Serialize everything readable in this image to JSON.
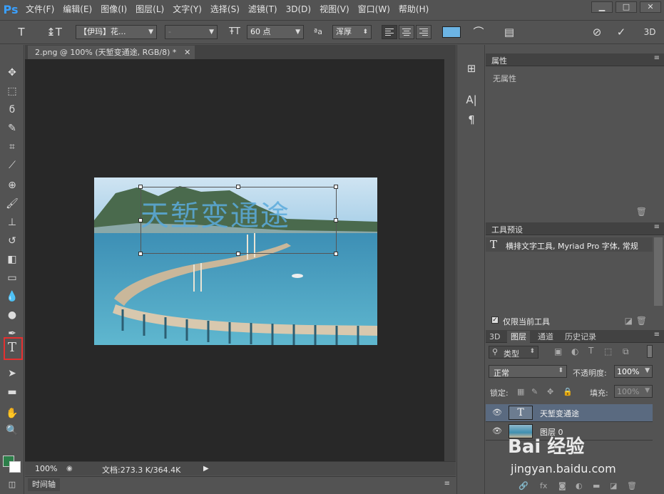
{
  "app": {
    "logo": "Ps"
  },
  "menu": [
    "文件(F)",
    "编辑(E)",
    "图像(I)",
    "图层(L)",
    "文字(Y)",
    "选择(S)",
    "滤镜(T)",
    "3D(D)",
    "视图(V)",
    "窗口(W)",
    "帮助(H)"
  ],
  "window_buttons": {
    "minimize": "▁",
    "maximize": "□",
    "close": "✕"
  },
  "options": {
    "font_family": "【伊玛】花...",
    "font_style": "-",
    "font_size": "60 点",
    "antialias_label": "ªa",
    "antialias": "浑厚",
    "text_color": "#6cb4e4"
  },
  "document": {
    "tab_title": "2.png @ 100% (天堑变通途, RGB/8) *",
    "tab_close": "✕",
    "zoom": "100%",
    "doc_info": "文档:273.3 K/364.4K",
    "canvas_text": "天堑变通途"
  },
  "timeline": {
    "label": "时间轴"
  },
  "panels": {
    "properties": {
      "title": "属性",
      "empty_text": "无属性"
    },
    "tool_presets": {
      "title": "工具预设",
      "item": "横排文字工具, Myriad Pro 字体, 常规",
      "current_only": "仅限当前工具"
    },
    "layers": {
      "tabs": [
        "3D",
        "图层",
        "通道",
        "历史记录"
      ],
      "filter_kind": "类型",
      "blend_mode": "正常",
      "opacity_label": "不透明度:",
      "opacity_value": "100%",
      "lock_label": "锁定:",
      "fill_label": "填充:",
      "fill_value": "100%",
      "items": [
        {
          "name": "天堑变通途",
          "type": "text"
        },
        {
          "name": "图层 0",
          "type": "image"
        }
      ]
    }
  },
  "watermark": {
    "logo": "Bai 经验",
    "url": "jingyan.baidu.com"
  },
  "colors": {
    "foreground": "#2d7f4a",
    "background": "#ffffff",
    "selection_highlight": "#e53030"
  }
}
